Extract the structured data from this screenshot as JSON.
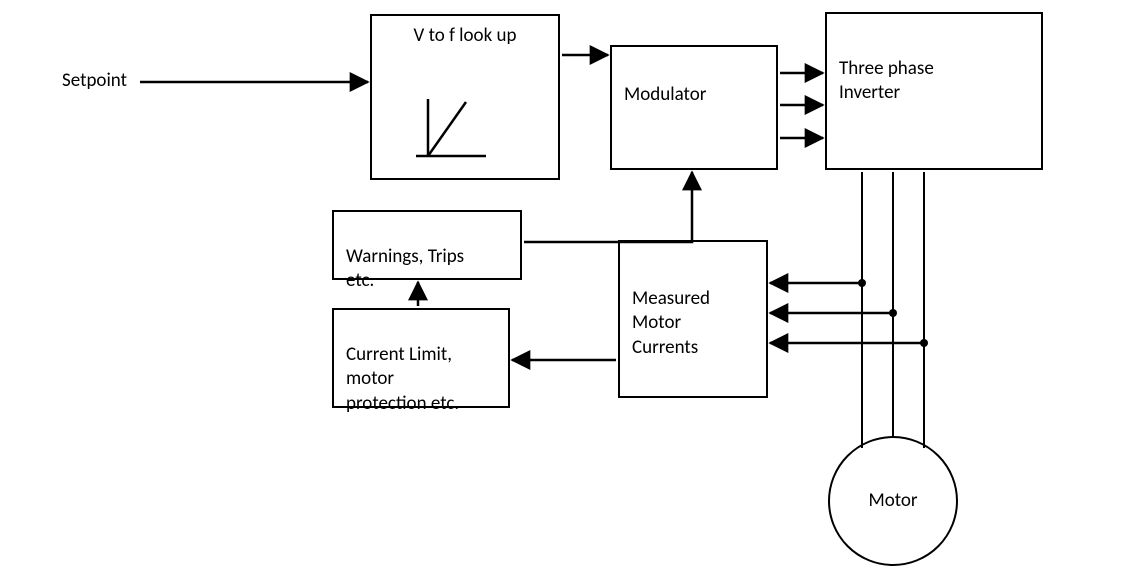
{
  "diagram": {
    "input_label": "Setpoint",
    "blocks": {
      "vf_lookup": "V to f look up",
      "modulator": "Modulator",
      "inverter": "Three phase\nInverter",
      "warnings": "Warnings, Trips\netc.",
      "current_limit": "Current Limit,\nmotor\nprotection etc.",
      "measured": "Measured\nMotor\nCurrents",
      "motor": "Motor"
    }
  }
}
